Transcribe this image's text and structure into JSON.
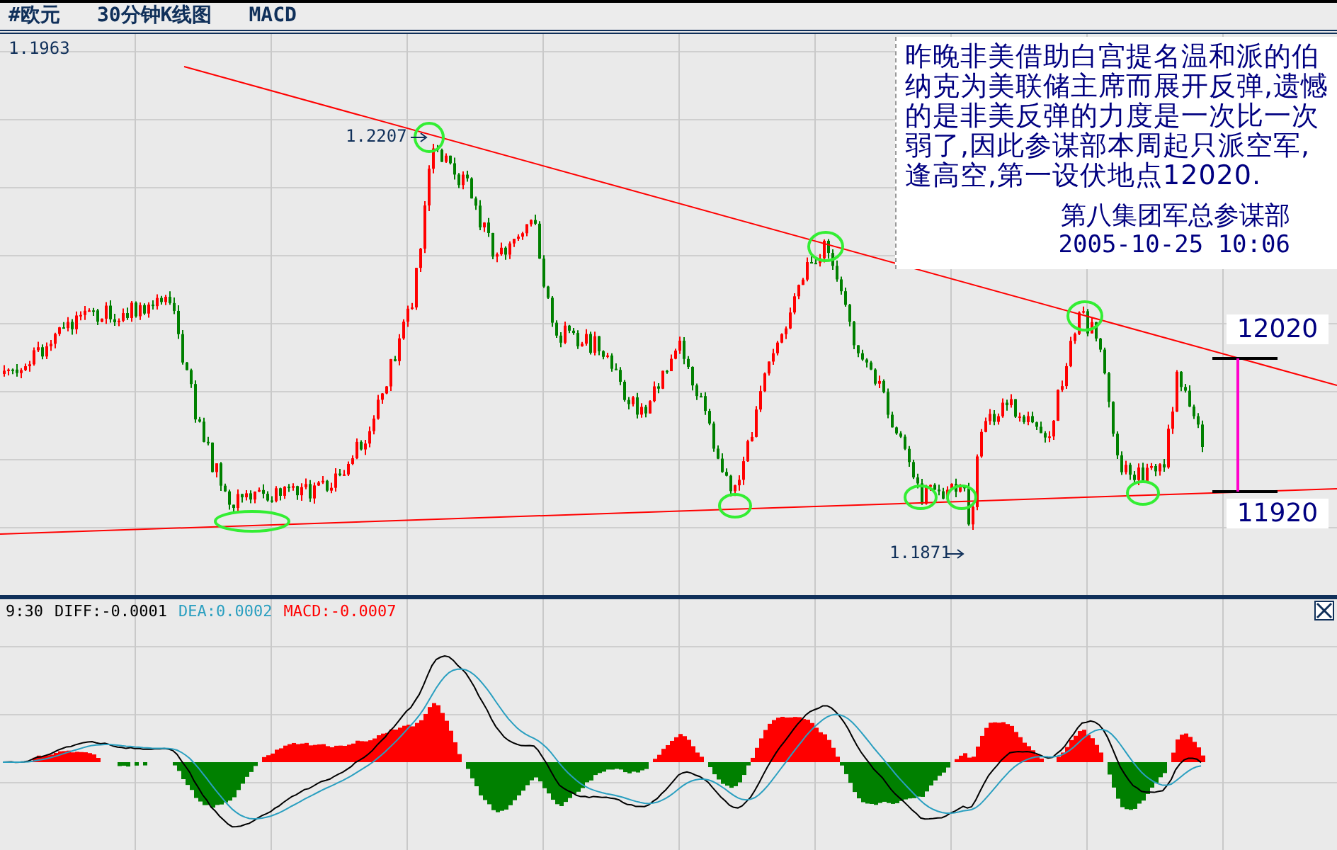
{
  "toolbar": {
    "items": [
      "#欧元",
      "30分钟K线图",
      "MACD"
    ]
  },
  "price_panel": {
    "top_price": "1.1963",
    "high_label": "1.2207",
    "low_label": "1.1871",
    "note": {
      "text": "昨晚非美借助白宫提名温和派的伯纳克为美联储主席而展开反弹,遗憾的是非美反弹的力度是一次比一次弱了,因此参谋部本周起只派空军,逢高空,第一设伏地点12020.",
      "signature": "第八集团军总参谋部",
      "timestamp": "2005-10-25 10:06"
    },
    "target_upper": "12020",
    "target_lower": "11920"
  },
  "macd_panel": {
    "time": "9:30",
    "diff": "DIFF:-0.0001",
    "dea": "DEA:0.0002",
    "macd": "MACD:-0.0007"
  }
}
